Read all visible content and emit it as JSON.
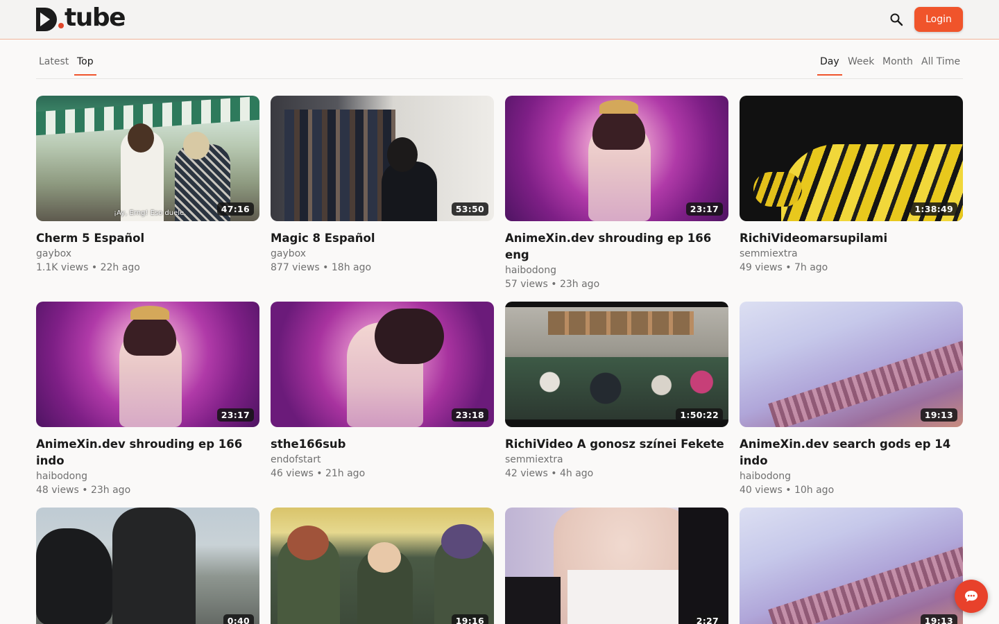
{
  "header": {
    "logo_text": "tube",
    "logo_alt": "D.tube",
    "login_label": "Login"
  },
  "feed_tabs": [
    {
      "label": "Latest",
      "active": false
    },
    {
      "label": "Top",
      "active": true
    }
  ],
  "period_tabs": [
    {
      "label": "Day",
      "active": true
    },
    {
      "label": "Week",
      "active": false
    },
    {
      "label": "Month",
      "active": false
    },
    {
      "label": "All Time",
      "active": false
    }
  ],
  "videos": [
    {
      "title": "Cherm 5 Español",
      "author": "gaybox",
      "views": "1.1K views",
      "age": "22h ago",
      "duration": "47:16",
      "subtitle": "¡Ay, Erng! Eso duele."
    },
    {
      "title": "Magic 8 Español",
      "author": "gaybox",
      "views": "877 views",
      "age": "18h ago",
      "duration": "53:50"
    },
    {
      "title": "AnimeXin.dev shrouding ep 166 eng",
      "author": "haibodong",
      "views": "57 views",
      "age": "23h ago",
      "duration": "23:17"
    },
    {
      "title": "RichiVideomarsupilami",
      "author": "semmiextra",
      "views": "49 views",
      "age": "7h ago",
      "duration": "1:38:49"
    },
    {
      "title": "AnimeXin.dev shrouding ep 166 indo",
      "author": "haibodong",
      "views": "48 views",
      "age": "23h ago",
      "duration": "23:17"
    },
    {
      "title": "sthe166sub",
      "author": "endofstart",
      "views": "46 views",
      "age": "21h ago",
      "duration": "23:18"
    },
    {
      "title": "RichiVideo A gonosz színei Fekete",
      "author": "semmiextra",
      "views": "42 views",
      "age": "4h ago",
      "duration": "1:50:22"
    },
    {
      "title": "AnimeXin.dev search gods ep 14 indo",
      "author": "haibodong",
      "views": "40 views",
      "age": "10h ago",
      "duration": "19:13"
    },
    {
      "duration": "0:40"
    },
    {
      "duration": "19:16"
    },
    {
      "duration": "2:27"
    },
    {
      "duration": "19:13"
    }
  ],
  "colors": {
    "accent": "#f0542b",
    "background": "#faf9f8",
    "chat_button": "#e8412b"
  },
  "icons": {
    "search": "search-icon",
    "chat": "chat-icon"
  }
}
